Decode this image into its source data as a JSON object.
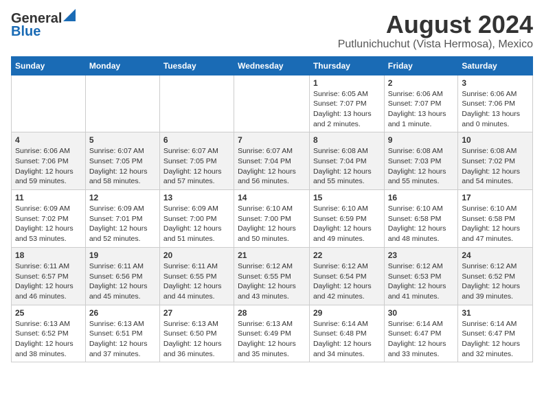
{
  "header": {
    "logo_line1": "General",
    "logo_line2": "Blue",
    "main_title": "August 2024",
    "subtitle": "Putlunichuchut (Vista Hermosa), Mexico"
  },
  "calendar": {
    "days_of_week": [
      "Sunday",
      "Monday",
      "Tuesday",
      "Wednesday",
      "Thursday",
      "Friday",
      "Saturday"
    ],
    "weeks": [
      [
        {
          "day": "",
          "info": ""
        },
        {
          "day": "",
          "info": ""
        },
        {
          "day": "",
          "info": ""
        },
        {
          "day": "",
          "info": ""
        },
        {
          "day": "1",
          "info": "Sunrise: 6:05 AM\nSunset: 7:07 PM\nDaylight: 13 hours\nand 2 minutes."
        },
        {
          "day": "2",
          "info": "Sunrise: 6:06 AM\nSunset: 7:07 PM\nDaylight: 13 hours\nand 1 minute."
        },
        {
          "day": "3",
          "info": "Sunrise: 6:06 AM\nSunset: 7:06 PM\nDaylight: 13 hours\nand 0 minutes."
        }
      ],
      [
        {
          "day": "4",
          "info": "Sunrise: 6:06 AM\nSunset: 7:06 PM\nDaylight: 12 hours\nand 59 minutes."
        },
        {
          "day": "5",
          "info": "Sunrise: 6:07 AM\nSunset: 7:05 PM\nDaylight: 12 hours\nand 58 minutes."
        },
        {
          "day": "6",
          "info": "Sunrise: 6:07 AM\nSunset: 7:05 PM\nDaylight: 12 hours\nand 57 minutes."
        },
        {
          "day": "7",
          "info": "Sunrise: 6:07 AM\nSunset: 7:04 PM\nDaylight: 12 hours\nand 56 minutes."
        },
        {
          "day": "8",
          "info": "Sunrise: 6:08 AM\nSunset: 7:04 PM\nDaylight: 12 hours\nand 55 minutes."
        },
        {
          "day": "9",
          "info": "Sunrise: 6:08 AM\nSunset: 7:03 PM\nDaylight: 12 hours\nand 55 minutes."
        },
        {
          "day": "10",
          "info": "Sunrise: 6:08 AM\nSunset: 7:02 PM\nDaylight: 12 hours\nand 54 minutes."
        }
      ],
      [
        {
          "day": "11",
          "info": "Sunrise: 6:09 AM\nSunset: 7:02 PM\nDaylight: 12 hours\nand 53 minutes."
        },
        {
          "day": "12",
          "info": "Sunrise: 6:09 AM\nSunset: 7:01 PM\nDaylight: 12 hours\nand 52 minutes."
        },
        {
          "day": "13",
          "info": "Sunrise: 6:09 AM\nSunset: 7:00 PM\nDaylight: 12 hours\nand 51 minutes."
        },
        {
          "day": "14",
          "info": "Sunrise: 6:10 AM\nSunset: 7:00 PM\nDaylight: 12 hours\nand 50 minutes."
        },
        {
          "day": "15",
          "info": "Sunrise: 6:10 AM\nSunset: 6:59 PM\nDaylight: 12 hours\nand 49 minutes."
        },
        {
          "day": "16",
          "info": "Sunrise: 6:10 AM\nSunset: 6:58 PM\nDaylight: 12 hours\nand 48 minutes."
        },
        {
          "day": "17",
          "info": "Sunrise: 6:10 AM\nSunset: 6:58 PM\nDaylight: 12 hours\nand 47 minutes."
        }
      ],
      [
        {
          "day": "18",
          "info": "Sunrise: 6:11 AM\nSunset: 6:57 PM\nDaylight: 12 hours\nand 46 minutes."
        },
        {
          "day": "19",
          "info": "Sunrise: 6:11 AM\nSunset: 6:56 PM\nDaylight: 12 hours\nand 45 minutes."
        },
        {
          "day": "20",
          "info": "Sunrise: 6:11 AM\nSunset: 6:55 PM\nDaylight: 12 hours\nand 44 minutes."
        },
        {
          "day": "21",
          "info": "Sunrise: 6:12 AM\nSunset: 6:55 PM\nDaylight: 12 hours\nand 43 minutes."
        },
        {
          "day": "22",
          "info": "Sunrise: 6:12 AM\nSunset: 6:54 PM\nDaylight: 12 hours\nand 42 minutes."
        },
        {
          "day": "23",
          "info": "Sunrise: 6:12 AM\nSunset: 6:53 PM\nDaylight: 12 hours\nand 41 minutes."
        },
        {
          "day": "24",
          "info": "Sunrise: 6:12 AM\nSunset: 6:52 PM\nDaylight: 12 hours\nand 39 minutes."
        }
      ],
      [
        {
          "day": "25",
          "info": "Sunrise: 6:13 AM\nSunset: 6:52 PM\nDaylight: 12 hours\nand 38 minutes."
        },
        {
          "day": "26",
          "info": "Sunrise: 6:13 AM\nSunset: 6:51 PM\nDaylight: 12 hours\nand 37 minutes."
        },
        {
          "day": "27",
          "info": "Sunrise: 6:13 AM\nSunset: 6:50 PM\nDaylight: 12 hours\nand 36 minutes."
        },
        {
          "day": "28",
          "info": "Sunrise: 6:13 AM\nSunset: 6:49 PM\nDaylight: 12 hours\nand 35 minutes."
        },
        {
          "day": "29",
          "info": "Sunrise: 6:14 AM\nSunset: 6:48 PM\nDaylight: 12 hours\nand 34 minutes."
        },
        {
          "day": "30",
          "info": "Sunrise: 6:14 AM\nSunset: 6:47 PM\nDaylight: 12 hours\nand 33 minutes."
        },
        {
          "day": "31",
          "info": "Sunrise: 6:14 AM\nSunset: 6:47 PM\nDaylight: 12 hours\nand 32 minutes."
        }
      ]
    ]
  }
}
